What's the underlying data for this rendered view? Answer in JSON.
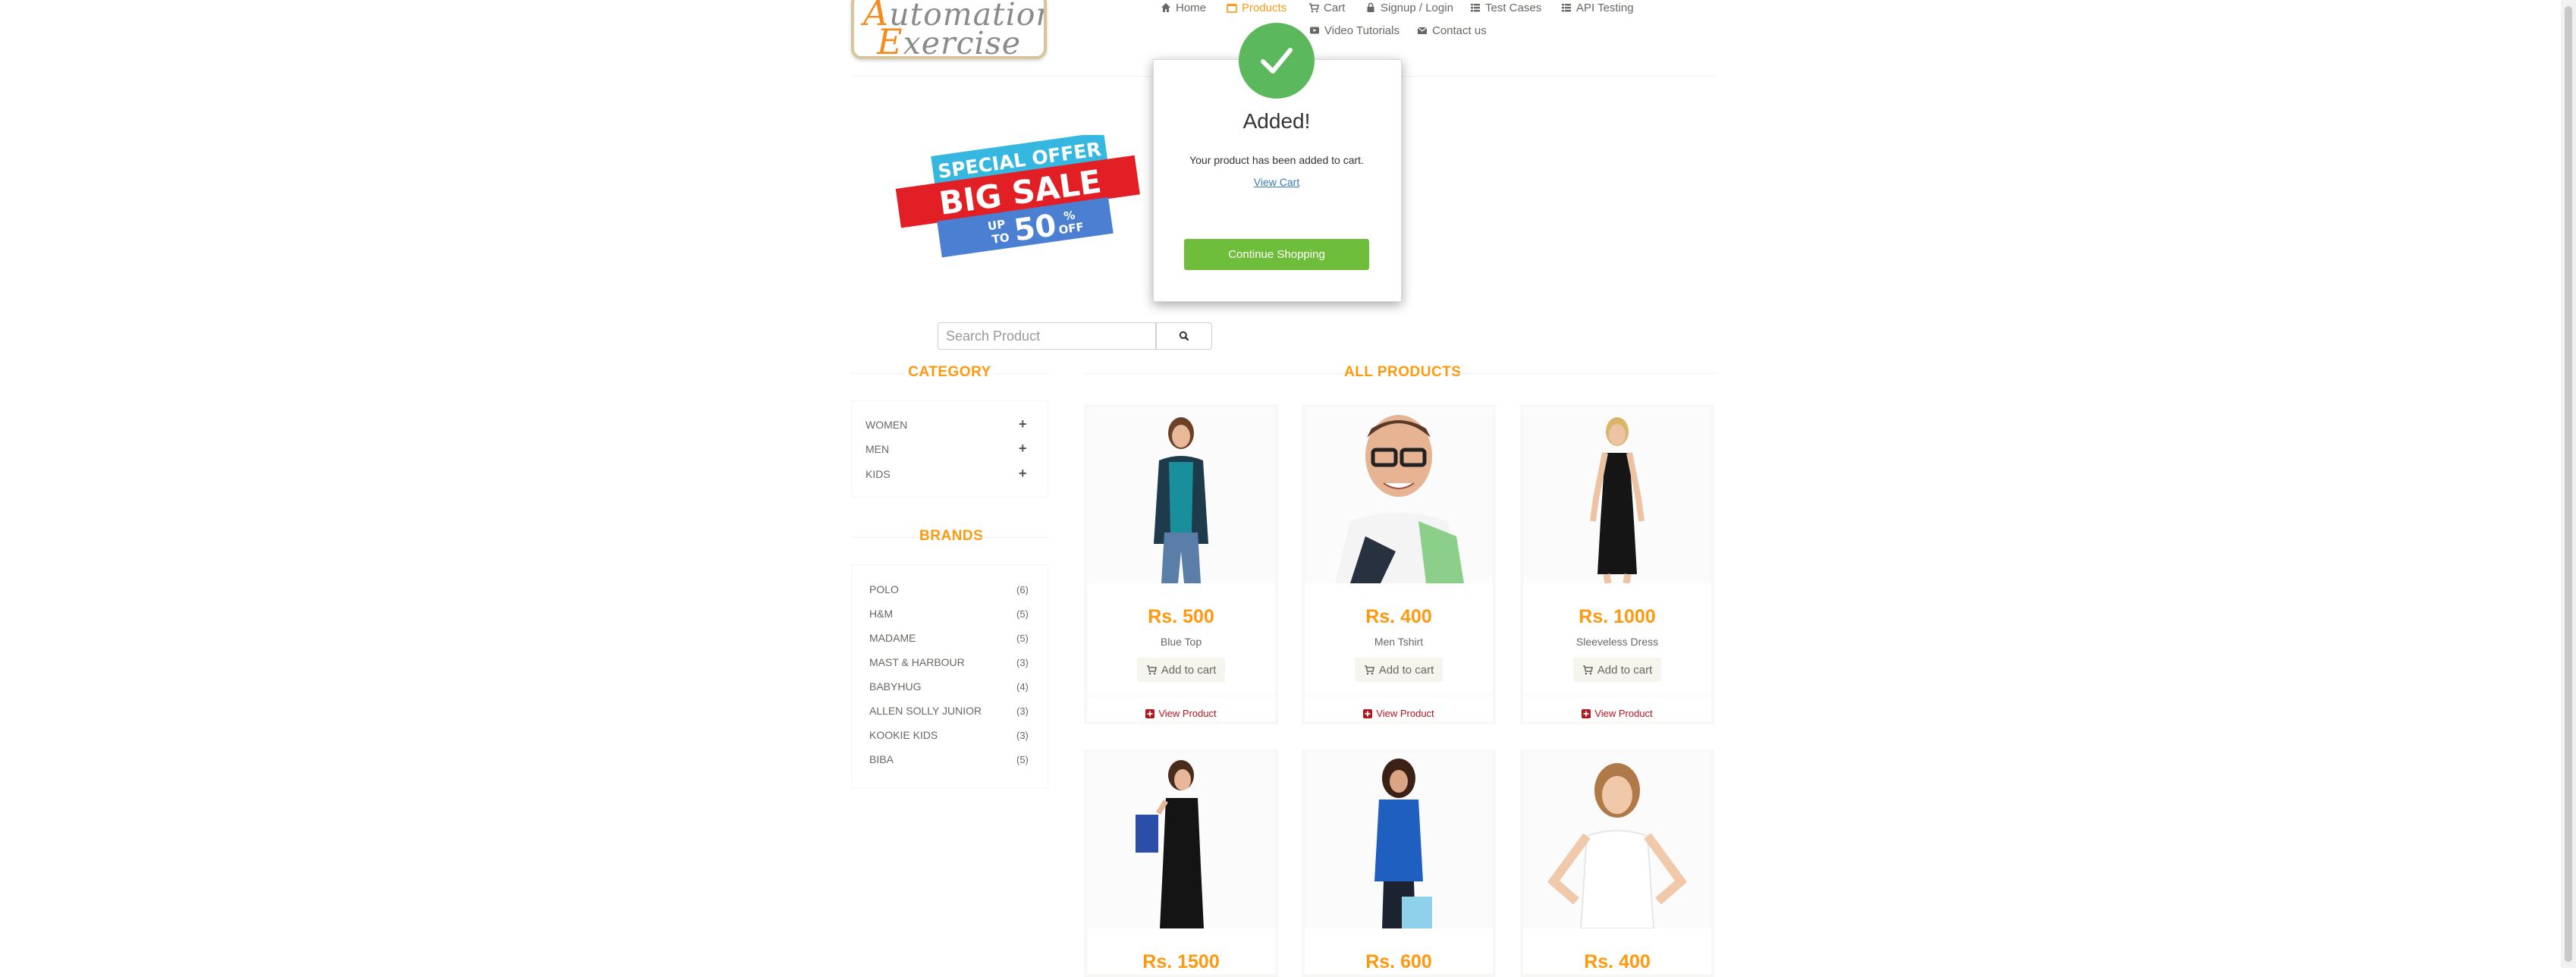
{
  "logo": {
    "line1_cap": "A",
    "line1_rest": "utomation",
    "line2_cap": "E",
    "line2_rest": "xercise"
  },
  "nav": [
    {
      "id": "home",
      "label": "Home",
      "icon": "home-icon"
    },
    {
      "id": "products",
      "label": "Products",
      "icon": "products-icon",
      "active": true
    },
    {
      "id": "cart",
      "label": "Cart",
      "icon": "cart-icon"
    },
    {
      "id": "signup",
      "label": "Signup / Login",
      "icon": "lock-icon"
    },
    {
      "id": "testcases",
      "label": "Test Cases",
      "icon": "list-icon"
    },
    {
      "id": "api",
      "label": "API Testing",
      "icon": "list-icon"
    },
    {
      "id": "video",
      "label": "Video Tutorials",
      "icon": "youtube-icon"
    },
    {
      "id": "contact",
      "label": "Contact us",
      "icon": "envelope-icon"
    }
  ],
  "banner": {
    "line1": "SPECIAL OFFER",
    "line2": "BIG SALE",
    "up": "UP",
    "to": "TO",
    "pct": "50",
    "percent_sign": "%",
    "off": "OFF"
  },
  "search": {
    "placeholder": "Search Product"
  },
  "sidebar": {
    "category_title": "CATEGORY",
    "categories": [
      "WOMEN",
      "MEN",
      "KIDS"
    ],
    "brands_title": "BRANDS",
    "brands": [
      {
        "name": "POLO",
        "count": "(6)"
      },
      {
        "name": "H&M",
        "count": "(5)"
      },
      {
        "name": "MADAME",
        "count": "(5)"
      },
      {
        "name": "MAST & HARBOUR",
        "count": "(3)"
      },
      {
        "name": "BABYHUG",
        "count": "(4)"
      },
      {
        "name": "ALLEN SOLLY JUNIOR",
        "count": "(3)"
      },
      {
        "name": "KOOKIE KIDS",
        "count": "(3)"
      },
      {
        "name": "BIBA",
        "count": "(5)"
      }
    ]
  },
  "products_title": "ALL PRODUCTS",
  "products": [
    {
      "price": "Rs. 500",
      "name": "Blue Top",
      "add": "Add to cart",
      "view": "View Product"
    },
    {
      "price": "Rs. 400",
      "name": "Men Tshirt",
      "add": "Add to cart",
      "view": "View Product"
    },
    {
      "price": "Rs. 1000",
      "name": "Sleeveless Dress",
      "add": "Add to cart",
      "view": "View Product"
    },
    {
      "price": "Rs. 1500"
    },
    {
      "price": "Rs. 600"
    },
    {
      "price": "Rs. 400"
    }
  ],
  "modal": {
    "title": "Added!",
    "body": "Your product has been added to cart.",
    "link": "View Cart",
    "button": "Continue Shopping"
  },
  "colors": {
    "accent": "#fe980f",
    "success": "#5cb85c",
    "button_green": "#6fbe3b",
    "link": "#337ab7"
  }
}
